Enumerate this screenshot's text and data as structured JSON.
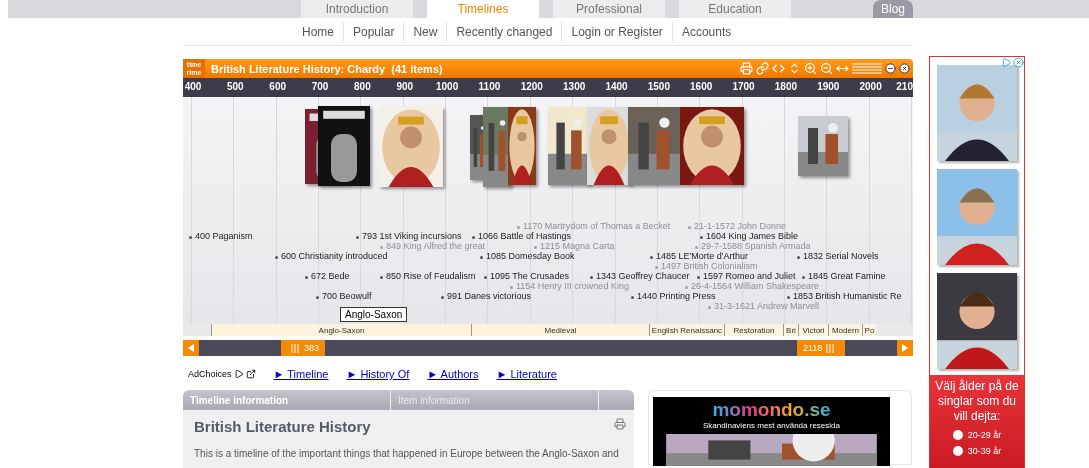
{
  "site_tabs": [
    {
      "label": "Introduction",
      "selected": false
    },
    {
      "label": "Timelines",
      "selected": true
    },
    {
      "label": "Professional",
      "selected": false
    },
    {
      "label": "Education",
      "selected": false
    }
  ],
  "blog_button": "Blog",
  "nav": [
    "Home",
    "Popular",
    "New",
    "Recently changed",
    "Login or Register",
    "Accounts"
  ],
  "timeline": {
    "logo": [
      "time",
      "rime"
    ],
    "title": "British Literature History: Chardy",
    "count": "(41 items)",
    "scale": [
      "400",
      "500",
      "600",
      "700",
      "800",
      "900",
      "1000",
      "1100",
      "1200",
      "1300",
      "1400",
      "1500",
      "1600",
      "1700",
      "1800",
      "1900",
      "2000",
      "210"
    ],
    "images": [
      {
        "kind": "cover"
      },
      {
        "kind": "cover"
      },
      {
        "kind": "portrait"
      },
      {
        "kind": "scene"
      },
      {
        "kind": "scene"
      },
      {
        "kind": "portrait"
      },
      {
        "kind": "scene"
      },
      {
        "kind": "portrait"
      },
      {
        "kind": "scene"
      },
      {
        "kind": "portrait"
      },
      {
        "kind": "scene"
      }
    ],
    "events": [
      {
        "label": "400 Paganism",
        "dimmed": false
      },
      {
        "label": "793 1st Viking incursions",
        "dimmed": false
      },
      {
        "label": "849 King Alfred the great",
        "dimmed": true
      },
      {
        "label": "600 Christianity introduced",
        "dimmed": false
      },
      {
        "label": "672 Bede",
        "dimmed": false
      },
      {
        "label": "850 Rise of Feudalism",
        "dimmed": false
      },
      {
        "label": "700 Beowulf",
        "dimmed": false
      },
      {
        "label": "991 Danes victorious",
        "dimmed": false
      },
      {
        "label": "1066 Battle of Hastings",
        "dimmed": false
      },
      {
        "label": "1170 Martrydom of Thomas a Becket",
        "dimmed": true
      },
      {
        "label": "1215 Magna Carta",
        "dimmed": true
      },
      {
        "label": "1085 Domesday Book",
        "dimmed": false
      },
      {
        "label": "1095 The Crusades",
        "dimmed": false
      },
      {
        "label": "1154 Henry III crowned King",
        "dimmed": true
      },
      {
        "label": "1343 Geoffrey Chaucer",
        "dimmed": false
      },
      {
        "label": "1440 Printing Press",
        "dimmed": false
      },
      {
        "label": "21-1-1572 John Donne",
        "dimmed": true
      },
      {
        "label": "1604 King James Bible",
        "dimmed": false
      },
      {
        "label": "29-7-1588 Spanish Armada",
        "dimmed": true
      },
      {
        "label": "1485 LE'Morte d'Arthur",
        "dimmed": false
      },
      {
        "label": "1497 British Colonialism",
        "dimmed": true
      },
      {
        "label": "1597 Romeo and Juliet",
        "dimmed": false
      },
      {
        "label": "26-4-1564 William Shakespeare",
        "dimmed": true
      },
      {
        "label": "31-3-1621 Andrew Marvell",
        "dimmed": true
      },
      {
        "label": "1832 Serial Novels",
        "dimmed": false
      },
      {
        "label": "1845 Great Famine",
        "dimmed": false
      },
      {
        "label": "1853 British Humanistic Re",
        "dimmed": false
      }
    ],
    "tooltip": "Anglo-Saxon",
    "eras": [
      "Anglo-Saxon",
      "Medieval",
      "English Renaissanc",
      "Restoration",
      "Bri",
      "Victori",
      "Modern",
      "Po"
    ],
    "range_start": "383",
    "range_end": "2118"
  },
  "ad_links": {
    "adchoices": "AdChoices",
    "links": [
      "► Timeline",
      "► History Of",
      "► Authors",
      "► Literature"
    ]
  },
  "info": {
    "tabs": [
      {
        "label": "Timeline information",
        "selected": true
      },
      {
        "label": "Item information",
        "selected": false
      }
    ],
    "heading": "British Literature History",
    "text": "This is a timeline of the important things that happened in Europe between the Anglo-Saxon and"
  },
  "momondo": {
    "brand": "momondo.se",
    "tagline": "Skandinaviens mest använda resesida"
  },
  "side_ad": {
    "prompt": "Välj ålder på de singlar som du vill dejta:",
    "options": [
      {
        "label": "20-29 år",
        "selected": false
      },
      {
        "label": "30-39 år",
        "selected": false
      }
    ]
  }
}
